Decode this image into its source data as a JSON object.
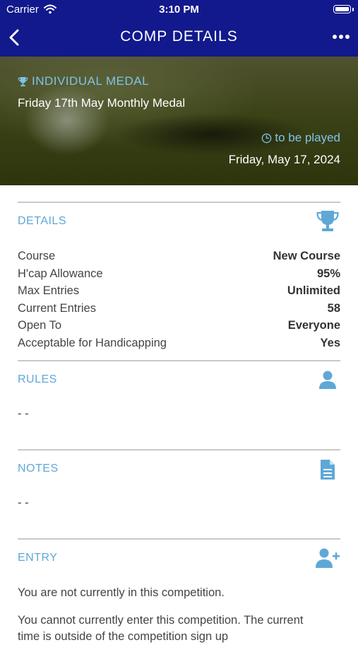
{
  "status_bar": {
    "carrier": "Carrier",
    "time": "3:10 PM"
  },
  "nav": {
    "title": "COMP DETAILS"
  },
  "hero": {
    "type": "INDIVIDUAL MEDAL",
    "name": "Friday 17th May Monthly Medal",
    "status": "to be played",
    "date": "Friday, May 17, 2024"
  },
  "details": {
    "title": "DETAILS",
    "rows": [
      {
        "label": "Course",
        "value": "New Course"
      },
      {
        "label": "H'cap Allowance",
        "value": "95%"
      },
      {
        "label": "Max Entries",
        "value": "Unlimited"
      },
      {
        "label": "Current Entries",
        "value": "58"
      },
      {
        "label": "Open To",
        "value": "Everyone"
      },
      {
        "label": "Acceptable for Handicapping",
        "value": "Yes"
      }
    ]
  },
  "rules": {
    "title": "RULES",
    "text": "- -"
  },
  "notes": {
    "title": "NOTES",
    "text": "- -"
  },
  "entry": {
    "title": "ENTRY",
    "line1": "You are not currently in this competition.",
    "line2": "You cannot currently enter this competition. The current time is outside of the competition sign up"
  },
  "icons": {
    "back": "chevron-left-icon",
    "more": "ellipsis-icon",
    "trophy": "trophy-icon",
    "clock": "clock-icon",
    "person": "person-icon",
    "document": "document-icon",
    "person_add": "person-add-icon",
    "wifi": "wifi-icon",
    "battery": "battery-icon"
  },
  "colors": {
    "nav": "#12198c",
    "accent": "#5fa8d6",
    "accent_light": "#7fc4ea"
  }
}
